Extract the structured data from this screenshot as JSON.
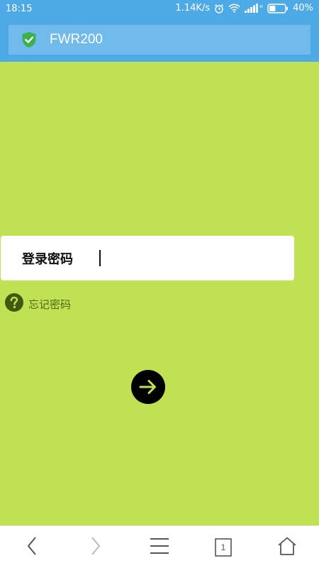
{
  "status_bar": {
    "time": "18:15",
    "speed": "1.14K/s",
    "battery": "40%",
    "battery_level": 0.4,
    "network_label": "4G"
  },
  "browser": {
    "address_text": "FWR200",
    "tab_count": "1"
  },
  "login": {
    "label": "登录密码",
    "password_value": "",
    "forgot_text": "忘记密码"
  },
  "colors": {
    "page_background": "#c0e153",
    "status_bar": "#4eaae6",
    "address_bar": "#71baec",
    "shield": "#3cb04a",
    "forgot_icon": "#3f5a10"
  },
  "icons": {
    "status": [
      "alarm-icon",
      "wifi-icon",
      "signal-icon",
      "battery-icon"
    ],
    "address": "shield-check-icon",
    "forgot": "question-circle-icon",
    "submit": "arrow-right-icon",
    "nav": [
      "back-icon",
      "forward-icon",
      "menu-icon",
      "tabs-icon",
      "home-icon"
    ]
  }
}
